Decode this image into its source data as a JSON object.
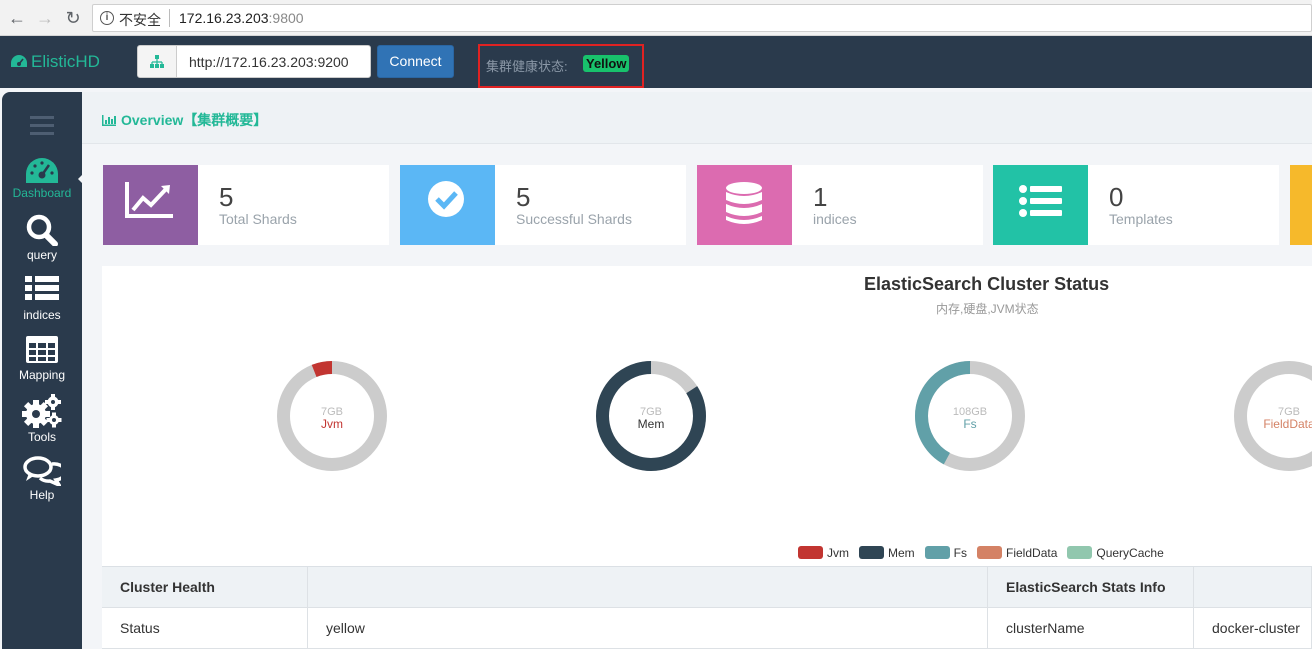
{
  "browser": {
    "security_label": "不安全",
    "url_host": "172.16.23.203",
    "url_port": ":9800"
  },
  "header": {
    "brand": "ElisticHD",
    "connect_url": "http://172.16.23.203:9200",
    "connect_label": "Connect",
    "health_label": "集群健康状态:",
    "health_value": "Yellow"
  },
  "sidebar": {
    "items": [
      {
        "label": "Dashboard",
        "icon": "dashboard-icon"
      },
      {
        "label": "query",
        "icon": "search-icon"
      },
      {
        "label": "indices",
        "icon": "list-icon"
      },
      {
        "label": "Mapping",
        "icon": "table-icon"
      },
      {
        "label": "Tools",
        "icon": "gears-icon"
      },
      {
        "label": "Help",
        "icon": "comments-icon"
      }
    ]
  },
  "page": {
    "title": "Overview【集群概要】"
  },
  "stats": [
    {
      "value": "5",
      "label": "Total Shards",
      "color": "#8e5ea2",
      "icon": "line-chart-icon"
    },
    {
      "value": "5",
      "label": "Successful Shards",
      "color": "#5bb7f5",
      "icon": "check-circle-icon"
    },
    {
      "value": "1",
      "label": "indices",
      "color": "#dc6bb0",
      "icon": "database-icon"
    },
    {
      "value": "0",
      "label": "Templates",
      "color": "#22c2a6",
      "icon": "list-icon"
    }
  ],
  "chart_data": {
    "type": "pie",
    "title": "ElasticSearch Cluster Status",
    "subtitle": "内存,硬盘,JVM状态",
    "donuts": [
      {
        "name": "Jvm",
        "total_label": "7GB",
        "fraction": 0.06,
        "color": "#c23531"
      },
      {
        "name": "Mem",
        "total_label": "7GB",
        "fraction": 0.84,
        "color": "#2f4554"
      },
      {
        "name": "Fs",
        "total_label": "108GB",
        "fraction": 0.42,
        "color": "#61a0a8"
      },
      {
        "name": "FieldData",
        "total_label": "7GB",
        "fraction": 0.0,
        "color": "#d48265"
      }
    ],
    "legend": [
      {
        "name": "Jvm",
        "color": "#c23531"
      },
      {
        "name": "Mem",
        "color": "#2f4554"
      },
      {
        "name": "Fs",
        "color": "#61a0a8"
      },
      {
        "name": "FieldData",
        "color": "#d48265"
      },
      {
        "name": "QueryCache",
        "color": "#91c7ae"
      }
    ]
  },
  "tables": {
    "health_header": "Cluster Health",
    "health_rows": [
      {
        "key": "Status",
        "value": "yellow"
      }
    ],
    "stats_header": "ElasticSearch Stats Info",
    "stats_rows": [
      {
        "key": "clusterName",
        "value": "docker-cluster"
      }
    ]
  }
}
